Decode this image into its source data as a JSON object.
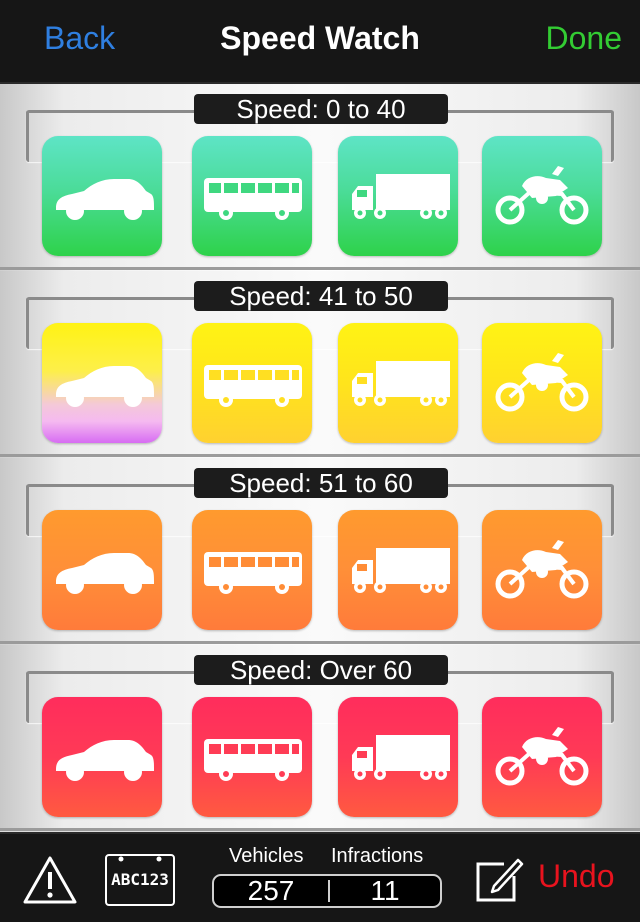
{
  "nav": {
    "back_label": "Back",
    "title": "Speed Watch",
    "done_label": "Done"
  },
  "sections": [
    {
      "label": "Speed: 0 to 40",
      "color": "#2ed24a"
    },
    {
      "label": "Speed: 41 to 50",
      "color": "#ffe41c"
    },
    {
      "label": "Speed: 51 to 60",
      "color": "#ff8f38"
    },
    {
      "label": "Speed: Over 60",
      "color": "#ff3a56"
    }
  ],
  "vehicle_icons": [
    "car-icon",
    "bus-icon",
    "truck-icon",
    "motorcycle-icon"
  ],
  "bottom": {
    "plate_text": "ABC123",
    "vehicles_label": "Vehicles",
    "infractions_label": "Infractions",
    "vehicles_count": "257",
    "infractions_count": "11",
    "undo_label": "Undo"
  },
  "colors": {
    "back": "#2f7fe0",
    "done": "#33cc33",
    "undo": "#e8131e"
  }
}
